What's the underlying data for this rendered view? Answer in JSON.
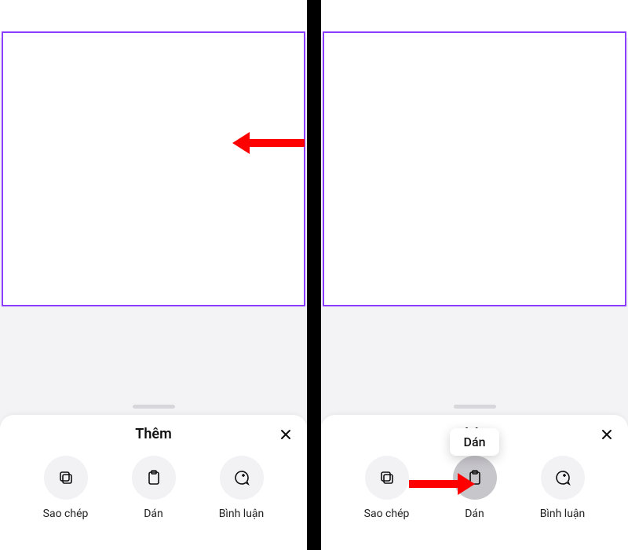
{
  "colors": {
    "canvas_border": "#8b3dff",
    "arrow": "#ff0000"
  },
  "left": {
    "sheet_title": "Thêm",
    "actions": [
      {
        "id": "copy",
        "label": "Sao chép",
        "icon": "copy-icon"
      },
      {
        "id": "paste",
        "label": "Dán",
        "icon": "clipboard-icon"
      },
      {
        "id": "comment",
        "label": "Bình luận",
        "icon": "comment-icon"
      }
    ]
  },
  "right": {
    "sheet_title": "Thêm",
    "tooltip": "Dán",
    "actions": [
      {
        "id": "copy",
        "label": "Sao chép",
        "icon": "copy-icon"
      },
      {
        "id": "paste",
        "label": "Dán",
        "icon": "clipboard-icon",
        "pressed": true
      },
      {
        "id": "comment",
        "label": "Bình luận",
        "icon": "comment-icon"
      }
    ]
  }
}
